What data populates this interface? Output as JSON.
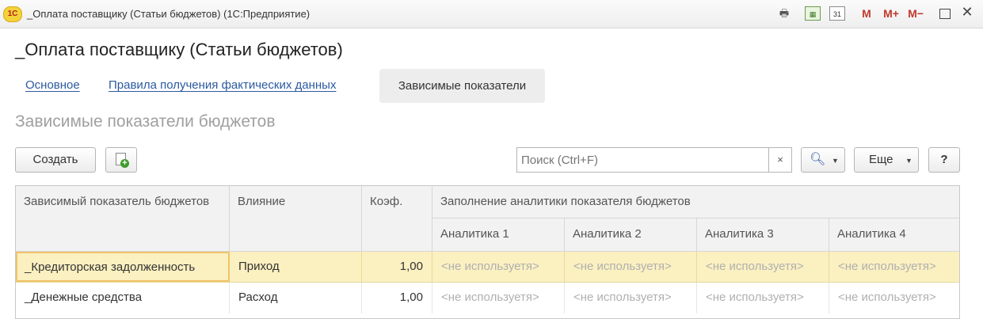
{
  "window": {
    "logo": "1С",
    "title": "_Оплата поставщику (Статьи бюджетов)  (1С:Предприятие)",
    "icons": [
      "print-icon",
      "calculator-icon",
      "calendar-icon",
      "memory-icon",
      "memory-plus-icon",
      "memory-minus-icon",
      "maximize-icon",
      "close-icon"
    ],
    "calendar_day": "31",
    "m_label": "M",
    "m_plus_label": "M+",
    "m_minus_label": "M−",
    "close_glyph": "✕"
  },
  "form": {
    "title": "_Оплата поставщику (Статьи бюджетов)",
    "tabs": [
      {
        "label": "Основное",
        "active": false
      },
      {
        "label": "Правила получения фактических данных",
        "active": false
      },
      {
        "label": "Зависимые показатели",
        "active": true
      }
    ],
    "section_title": "Зависимые показатели бюджетов"
  },
  "toolbar": {
    "create_label": "Создать",
    "search_placeholder": "Поиск (Ctrl+F)",
    "clear_glyph": "×",
    "more_label": "Еще",
    "help_label": "?"
  },
  "table": {
    "headers": {
      "indicator": "Зависимый показатель бюджетов",
      "influence": "Влияние",
      "coef": "Коэф.",
      "analytics_group": "Заполнение аналитики показателя бюджетов",
      "analytics": [
        "Аналитика 1",
        "Аналитика 2",
        "Аналитика 3",
        "Аналитика 4"
      ]
    },
    "rows": [
      {
        "indicator": "_Кредиторская задолженность",
        "influence": "Приход",
        "coef": "1,00",
        "analytics": [
          "<не используетя>",
          "<не используетя>",
          "<не используетя>",
          "<не используетя>"
        ],
        "selected": true
      },
      {
        "indicator": "_Денежные средства",
        "influence": "Расход",
        "coef": "1,00",
        "analytics": [
          "<не используетя>",
          "<не используетя>",
          "<не используетя>",
          "<не используетя>"
        ],
        "selected": false
      }
    ]
  },
  "colors": {
    "accent_link": "#2c5aa0",
    "selected_row": "#fbf0c0",
    "header_bg": "#f2f2f2"
  }
}
